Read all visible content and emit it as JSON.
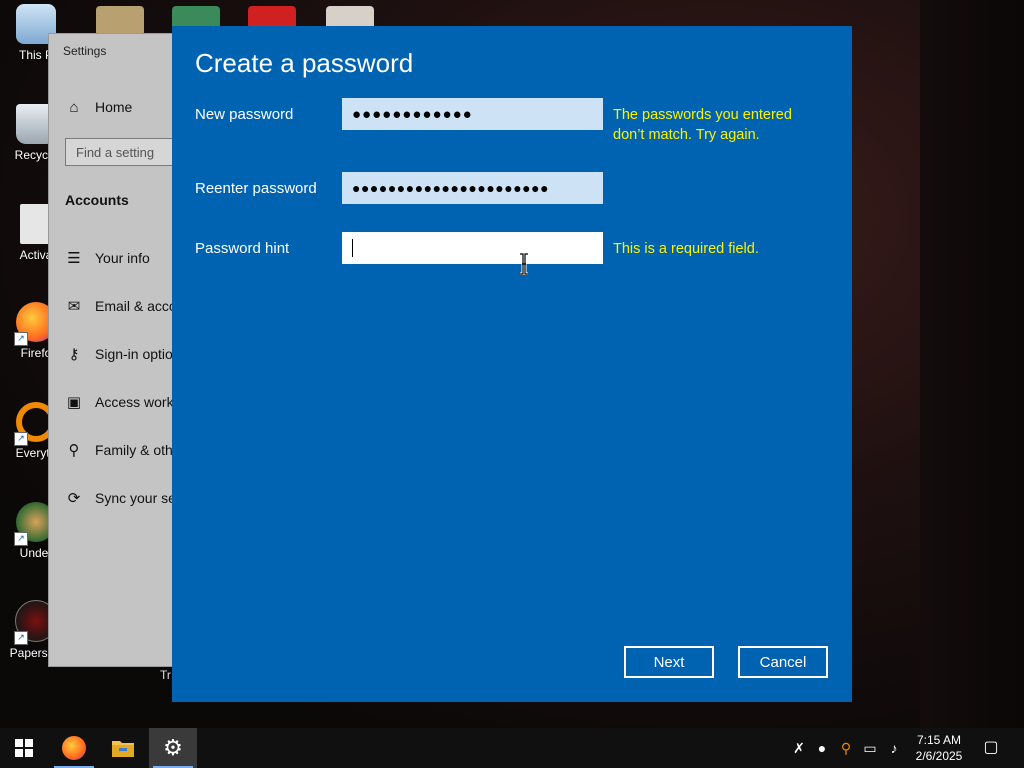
{
  "desktop": {
    "icons": [
      {
        "label": "This P",
        "icon": "computer-icon"
      },
      {
        "label": "Recycle",
        "icon": "recycle-bin-icon"
      },
      {
        "label": "Activa",
        "icon": "file-icon"
      },
      {
        "label": "Firefo",
        "icon": "firefox-icon"
      },
      {
        "label": "Everyth",
        "icon": "search-magnifier-icon"
      },
      {
        "label": "Under",
        "icon": "game-icon"
      },
      {
        "label": "Papers, P",
        "icon": "seal-icon"
      }
    ],
    "partial_label": "Tr"
  },
  "settings": {
    "title": "Settings",
    "home": "Home",
    "search_placeholder": "Find a setting",
    "section": "Accounts",
    "nav": [
      {
        "label": "Your info",
        "icon": "person-card-icon"
      },
      {
        "label": "Email & acco",
        "icon": "mail-icon"
      },
      {
        "label": "Sign-in optio",
        "icon": "key-icon"
      },
      {
        "label": "Access work",
        "icon": "briefcase-icon"
      },
      {
        "label": "Family & oth",
        "icon": "person-add-icon"
      },
      {
        "label": "Sync your se",
        "icon": "sync-icon"
      }
    ]
  },
  "dialog": {
    "title": "Create a password",
    "new_password_label": "New password",
    "new_password_value": "●●●●●●●●●●●●",
    "reenter_label": "Reenter password",
    "reenter_value": "●●●●●●●●●●●●●●●●●●●●●●",
    "hint_label": "Password hint",
    "hint_value": "",
    "mismatch_error": "The passwords you entered don’t match. Try again.",
    "required_error": "This is a required field.",
    "next_label": "Next",
    "cancel_label": "Cancel",
    "error_color": "#fff200",
    "accent_color": "#0063b1"
  },
  "taskbar": {
    "time": "7:15 AM",
    "date": "2/6/2025"
  }
}
